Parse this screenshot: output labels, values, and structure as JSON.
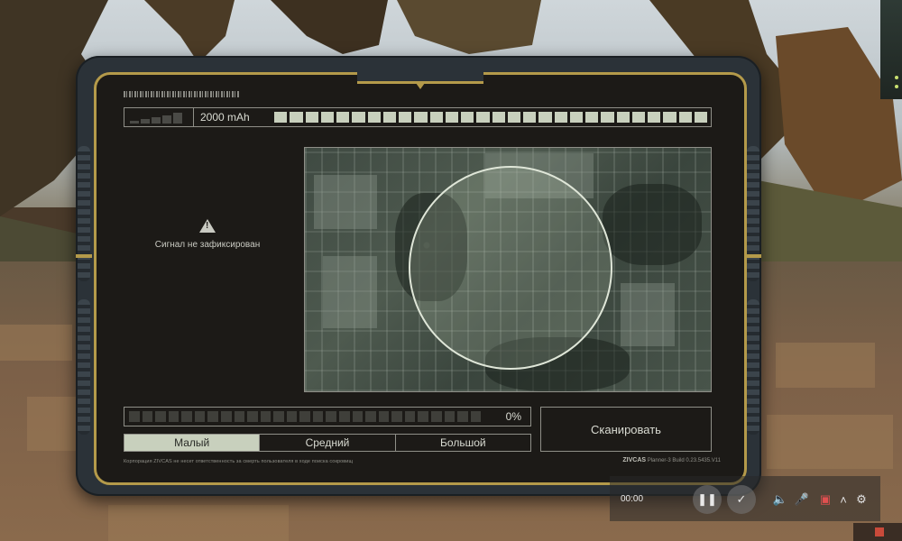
{
  "device": {
    "battery_label": "2000 mAh",
    "battery_cells": 28,
    "signal_bars": 5,
    "alert_text": "Сигнал не зафиксирован",
    "progress_label": "0%",
    "progress_cells": 27,
    "progress_fraction": 0,
    "scan_button_label": "Сканировать",
    "size_options": [
      "Малый",
      "Средний",
      "Большой"
    ],
    "size_selected": "Малый",
    "footer_disclaimer": "Корпорация ZIVCAS не несет ответственность за смерть пользователя в ходе поиска сокровищ",
    "footer_brand": "ZIVCAS",
    "footer_build": "Planner-3 Build 0.23.5435.V11"
  },
  "recorder": {
    "time": "00:00",
    "pause_icon": "pause-icon",
    "check_icon": "check-icon",
    "volume_icon": "volume-icon",
    "mic_icon": "mic-muted-icon",
    "camera_icon": "camera-off-icon",
    "chevron_icon": "chevron-up-icon",
    "settings_icon": "gear-icon"
  },
  "colors": {
    "frame_gold": "#b49a4a",
    "panel_bg": "#1c1a17",
    "cell_fill": "#c8d0bd",
    "text": "#d9dbd2"
  }
}
